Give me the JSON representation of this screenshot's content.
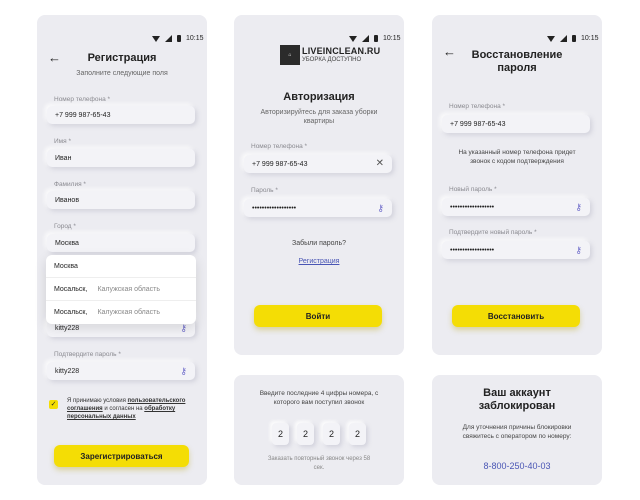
{
  "status_time": "10:15",
  "register": {
    "title": "Регистрация",
    "subtitle": "Заполните следующие поля",
    "phone_label": "Номер телефона *",
    "phone_value": "+7  999 987-65-43",
    "name_label": "Имя *",
    "name_value": "Иван",
    "surname_label": "Фамилия *",
    "surname_value": "Иванов",
    "city_label": "Город *",
    "city_value": "Москва",
    "city_options": [
      {
        "name": "Москва",
        "region": ""
      },
      {
        "name": "Мосальск,",
        "region": "Калужская область"
      },
      {
        "name": "Мосальск,",
        "region": "Калужская область"
      }
    ],
    "password_value": "kitty228",
    "confirm_label": "Подтвердите пароль *",
    "confirm_value": "kitty228",
    "agree_prefix": "Я принимаю условия ",
    "agree_link1": "пользовательского соглашения",
    "agree_mid": " и согласен на ",
    "agree_link2": "обработку персональных данных",
    "submit_label": "Зарегистрироваться"
  },
  "login": {
    "logo_text": "LIVEINCLEAN.RU",
    "logo_sub": "УБОРКА ДОСТУПНО",
    "title": "Авторизация",
    "subtitle": "Авторизируйтесь для заказа уборки квартиры",
    "phone_label": "Номер телефона *",
    "phone_value": "+7  999 987-65-43",
    "password_label": "Пароль *",
    "password_value": "••••••••••••••••••",
    "forgot_label": "Забыли пароль?",
    "register_link": "Регистрация",
    "submit_label": "Войти"
  },
  "recovery": {
    "title": "Восстановление пароля",
    "phone_label": "Номер телефона *",
    "phone_value": "+7  999 987-65-43",
    "info": "На указанный номер телефона придет звонок с кодом подтверждения",
    "new_password_label": "Новый пароль *",
    "new_password_value": "••••••••••••••••••",
    "confirm_label": "Подтвердите новый пароль *",
    "confirm_value": "••••••••••••••••••",
    "submit_label": "Восстановить"
  },
  "code": {
    "instruction": "Введите последние 4 цифры номера, с которого вам поступил звонок",
    "digits": [
      "2",
      "2",
      "2",
      "2"
    ],
    "resend": "Заказать повторный звонок через 58 сек."
  },
  "blocked": {
    "title": "Ваш аккаунт заблокирован",
    "info": "Для уточнения причины блокировки свяжитесь с оператором по номеру:",
    "phone": "8-800-250-40-03"
  },
  "colors": {
    "accent": "#f4dd05",
    "link": "#4a56b5",
    "panel": "#ececf1"
  }
}
